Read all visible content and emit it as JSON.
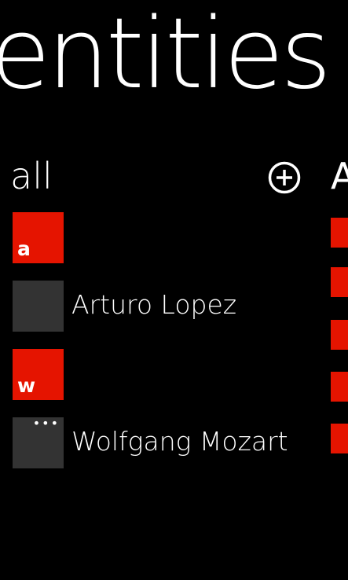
{
  "panorama": {
    "title": "entities"
  },
  "section": {
    "header": "all",
    "next_header_peek": "A"
  },
  "groups": [
    {
      "letter": "a",
      "contacts": [
        {
          "name": "Arturo Lopez"
        }
      ]
    },
    {
      "letter": "w",
      "contacts": [
        {
          "name": "Wolfgang Mozart",
          "avatar_overlay": "•••"
        }
      ]
    }
  ],
  "colors": {
    "accent": "#e51400",
    "background": "#000000",
    "avatar_placeholder": "#333333",
    "text": "#ffffff"
  },
  "icons": {
    "add": "plus-circle"
  }
}
